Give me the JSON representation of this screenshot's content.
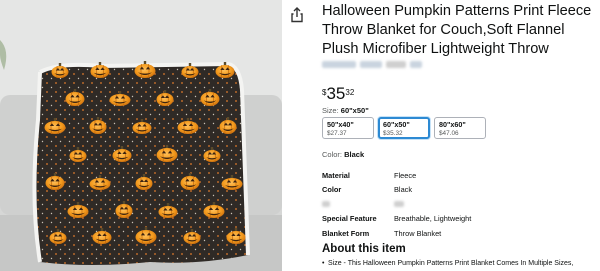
{
  "product": {
    "title": "Halloween Pumpkin Patterns Print Fleece Throw Blanket for Couch,Soft Flannel Plush Microfiber Lightweight Throw"
  },
  "price": {
    "symbol": "$",
    "whole": "35",
    "fraction": "32"
  },
  "size": {
    "label": "Size:",
    "selected": "60\"x50\"",
    "options": [
      {
        "name": "50\"x40\"",
        "price": "$27.37"
      },
      {
        "name": "60\"x50\"",
        "price": "$35.32"
      },
      {
        "name": "80\"x60\"",
        "price": "$47.06"
      }
    ]
  },
  "color": {
    "label": "Color:",
    "value": "Black"
  },
  "specs": [
    {
      "key": "Material",
      "value": "Fleece"
    },
    {
      "key": "Color",
      "value": "Black"
    },
    {
      "key": "",
      "value": ""
    },
    {
      "key": "Special Feature",
      "value": "Breathable, Lightweight"
    },
    {
      "key": "Blanket Form",
      "value": "Throw Blanket"
    }
  ],
  "about": {
    "heading": "About this item",
    "bullets": [
      "Size - This Halloween Pumpkin Patterns Print Blanket Comes In Multiple Sizes,"
    ]
  },
  "icons": {
    "share": "share-icon"
  },
  "colors": {
    "accent": "#2d8ad3",
    "pumpkin": "#f29a1e",
    "blanket": "#2f2a26"
  }
}
